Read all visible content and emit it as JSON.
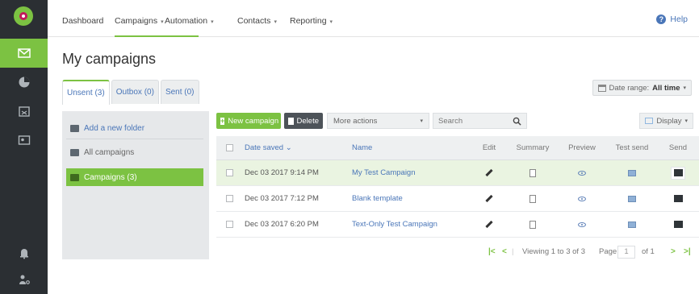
{
  "sidebar": {
    "icons": [
      "logo-icon",
      "mail-icon",
      "pie-chart-icon",
      "calendar-icon",
      "contacts-card-icon",
      "bell-icon",
      "user-settings-icon"
    ]
  },
  "topnav": {
    "items": [
      {
        "label": "Dashboard",
        "caret": ""
      },
      {
        "label": "Campaigns",
        "caret": "▾"
      },
      {
        "label": "Automation",
        "caret": "▾"
      },
      {
        "label": "Contacts",
        "caret": "▾"
      },
      {
        "label": "Reporting",
        "caret": "▾"
      }
    ],
    "active": "Campaigns",
    "help_label": "Help"
  },
  "page": {
    "title": "My campaigns"
  },
  "tabs": [
    {
      "label": "Unsent (3)"
    },
    {
      "label": "Outbox (0)"
    },
    {
      "label": "Sent (0)"
    }
  ],
  "date_range": {
    "label": "Date range:",
    "value": "All time"
  },
  "folders": {
    "add_label": "Add a new folder",
    "all_label": "All campaigns",
    "active_label": "Campaigns (3)"
  },
  "toolbar": {
    "new_label": "New campaign",
    "delete_label": "Delete",
    "more_actions": "More actions",
    "search_placeholder": "Search",
    "display_label": "Display"
  },
  "table": {
    "headers": {
      "date": "Date saved",
      "date_sort": "⌄",
      "name": "Name",
      "edit": "Edit",
      "summary": "Summary",
      "preview": "Preview",
      "test_send": "Test send",
      "send": "Send"
    },
    "rows": [
      {
        "date": "Dec 03 2017 9:14 PM",
        "name": "My Test Campaign"
      },
      {
        "date": "Dec 03 2017 7:12 PM",
        "name": "Blank template"
      },
      {
        "date": "Dec 03 2017 6:20 PM",
        "name": "Text-Only Test Campaign"
      }
    ]
  },
  "pager": {
    "first": "|<",
    "prev": "<",
    "viewing": "Viewing 1 to 3 of 3",
    "page_label": "Page",
    "page_value": "1",
    "of_label": "of 1",
    "next": ">",
    "last": ">|"
  },
  "colors": {
    "accent": "#7cc242",
    "sidebar": "#2b2f33",
    "link": "#4a76b8"
  }
}
